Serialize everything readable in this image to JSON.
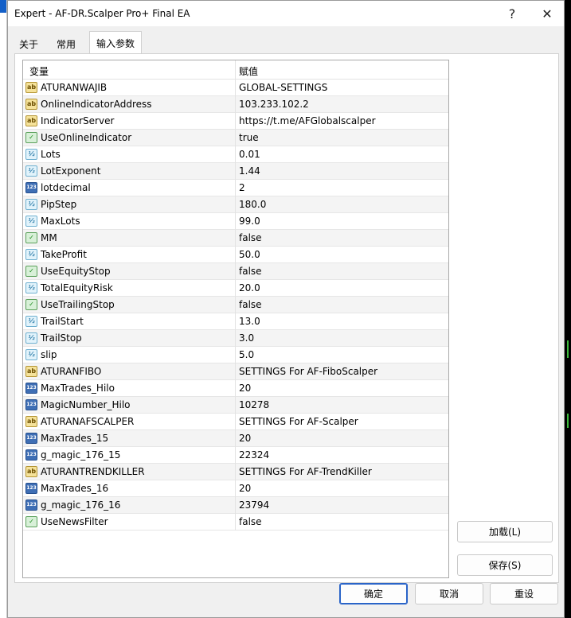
{
  "window": {
    "title": "Expert - AF-DR.Scalper Pro+ Final EA",
    "help_glyph": "?",
    "close_glyph": "✕"
  },
  "tabs": [
    {
      "label": "关于"
    },
    {
      "label": "常用"
    },
    {
      "label": "输入参数",
      "active": true
    }
  ],
  "grid": {
    "headers": {
      "variable": "变量",
      "value": "赋值"
    },
    "rows": [
      {
        "type": "ab",
        "name": "ATURANWAJIB",
        "value": "GLOBAL-SETTINGS"
      },
      {
        "type": "ab",
        "name": "OnlineIndicatorAddress",
        "value": "103.233.102.2"
      },
      {
        "type": "ab",
        "name": "IndicatorServer",
        "value": "https://t.me/AFGlobalscalper"
      },
      {
        "type": "bool",
        "name": "UseOnlineIndicator",
        "value": "true"
      },
      {
        "type": "dbl",
        "name": "Lots",
        "value": "0.01"
      },
      {
        "type": "dbl",
        "name": "LotExponent",
        "value": "1.44"
      },
      {
        "type": "int",
        "name": "lotdecimal",
        "value": "2"
      },
      {
        "type": "dbl",
        "name": "PipStep",
        "value": "180.0"
      },
      {
        "type": "dbl",
        "name": "MaxLots",
        "value": "99.0"
      },
      {
        "type": "bool",
        "name": "MM",
        "value": "false"
      },
      {
        "type": "dbl",
        "name": "TakeProfit",
        "value": "50.0"
      },
      {
        "type": "bool",
        "name": "UseEquityStop",
        "value": "false"
      },
      {
        "type": "dbl",
        "name": "TotalEquityRisk",
        "value": "20.0"
      },
      {
        "type": "bool",
        "name": "UseTrailingStop",
        "value": "false"
      },
      {
        "type": "dbl",
        "name": "TrailStart",
        "value": "13.0"
      },
      {
        "type": "dbl",
        "name": "TrailStop",
        "value": "3.0"
      },
      {
        "type": "dbl",
        "name": "slip",
        "value": "5.0"
      },
      {
        "type": "ab",
        "name": "ATURANFIBO",
        "value": "SETTINGS For AF-FiboScalper"
      },
      {
        "type": "int",
        "name": "MaxTrades_Hilo",
        "value": "20"
      },
      {
        "type": "int",
        "name": "MagicNumber_Hilo",
        "value": "10278"
      },
      {
        "type": "ab",
        "name": "ATURANAFSCALPER",
        "value": "SETTINGS For AF-Scalper"
      },
      {
        "type": "int",
        "name": "MaxTrades_15",
        "value": "20"
      },
      {
        "type": "int",
        "name": "g_magic_176_15",
        "value": "22324"
      },
      {
        "type": "ab",
        "name": "ATURANTRENDKILLER",
        "value": "SETTINGS For AF-TrendKiller"
      },
      {
        "type": "int",
        "name": "MaxTrades_16",
        "value": "20"
      },
      {
        "type": "int",
        "name": "g_magic_176_16",
        "value": "23794"
      },
      {
        "type": "bool",
        "name": "UseNewsFilter",
        "value": "false"
      }
    ]
  },
  "icon_glyphs": {
    "ab": "ab",
    "bool": "✓",
    "dbl": "½",
    "int": "123"
  },
  "buttons": {
    "load": "加载(L)",
    "save": "保存(S)",
    "ok": "确定",
    "cancel": "取消",
    "reset": "重设"
  }
}
